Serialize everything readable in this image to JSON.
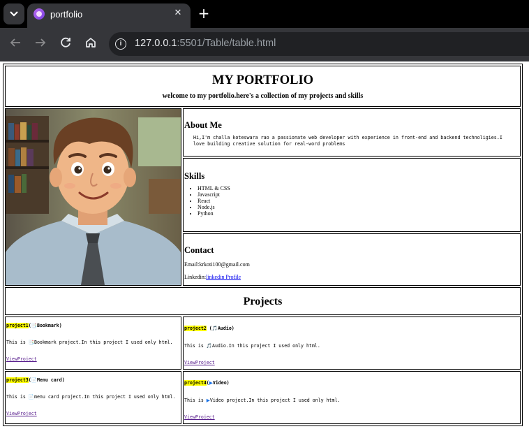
{
  "browser": {
    "tab": {
      "title": "portfolio",
      "close_icon": "close-icon",
      "favicon_color": "#9b59f0"
    },
    "new_tab_icon": "plus-icon",
    "tab_menu_icon": "chevron-down-icon",
    "url": {
      "host": "127.0.0.1",
      "rest": ":5501/Table/table.html"
    },
    "colors": {
      "tabbar": "#000000",
      "toolbar": "#35363a",
      "omnibox": "#202124"
    }
  },
  "header": {
    "title": "MY PORTFOLIO",
    "subtitle": "welcome to my portfolio.here's a collection of my projects and skills"
  },
  "about": {
    "heading": "About Me",
    "text": "Hi,I'm challa koteswara rao a passionate web developer with experience in front-end and backend technoligies.I love building creative solution for real-word problems"
  },
  "skills": {
    "heading": "Skills",
    "items": [
      "HTML & CSS",
      "Javascript",
      "React",
      "Node.js",
      "Python"
    ]
  },
  "contact": {
    "heading": "Contact",
    "email": "Email:krkoti100@gmail.com",
    "linkedin_label": "Linkedin:",
    "linkedin_link": "linkedin  Profile"
  },
  "projects": {
    "heading": "Projects",
    "items": [
      {
        "tag": "project1",
        "open": "(",
        "emoji": "📑",
        "name": "Bookmark)",
        "desc_pre": "This is ",
        "desc_post": "Bookmark project.In this project I used only html.",
        "link": "ViewProject"
      },
      {
        "tag": "project2",
        "open": " (",
        "emoji": "🎵",
        "name": "Audio)",
        "desc_pre": "This is ",
        "desc_post": "Audio.In this project I used only html.",
        "link": "ViewProject"
      },
      {
        "tag": "project3",
        "open": "(",
        "emoji": "📄",
        "name": "Menu card)",
        "desc_pre": "This is ",
        "desc_post": "menu card project.In this project I used only html.",
        "link": "ViewProject"
      },
      {
        "tag": "project4",
        "open": "(",
        "emoji": "▶",
        "name": "Video)",
        "desc_pre": "This is ",
        "desc_post": "Video project.In this project I used only html.",
        "link": "ViewProject"
      }
    ]
  },
  "accent_colors": {
    "highlight": "#ffff00",
    "link": "#0000ee",
    "visited_link": "#551a8b"
  }
}
